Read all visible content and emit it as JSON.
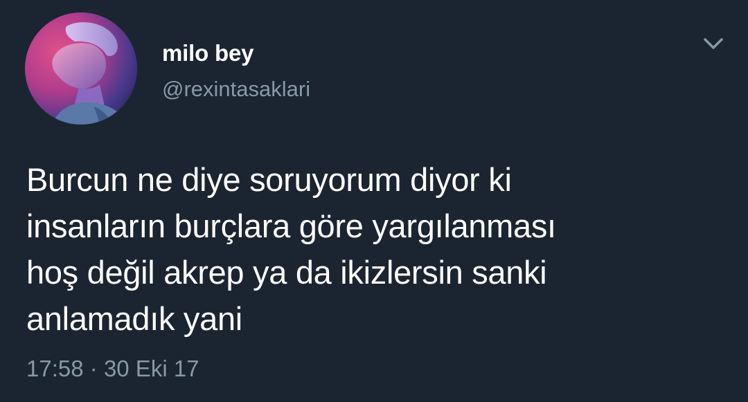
{
  "tweet": {
    "author": {
      "display_name": "milo bey",
      "handle": "@rexintasaklari"
    },
    "text_lines": [
      "Burcun ne diye soruyorum diyor ki",
      "insanların burçlara göre yargılanması",
      "hoş değil akrep ya da ikizlersin sanki",
      "anlamadık yani"
    ],
    "time": "17:58",
    "separator": "·",
    "date": "30 Eki 17",
    "menu_icon": "chevron-down-icon"
  },
  "colors": {
    "background": "#1b2532",
    "primary_text": "#ffffff",
    "secondary_text": "#8899a6"
  }
}
